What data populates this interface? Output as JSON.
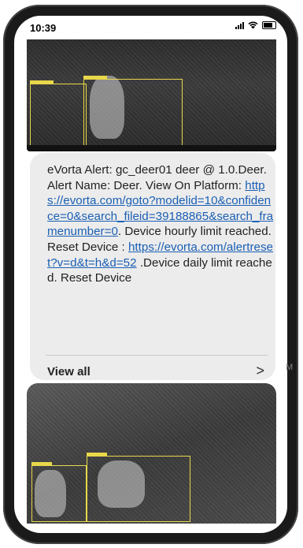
{
  "status_bar": {
    "time": "10:39"
  },
  "message": {
    "text_1": "eVorta Alert: gc_deer01 deer @ 1.0.Deer. Alert Name: Deer. View On Platform: ",
    "link_1": "https://evorta.com/goto?modelid=10&confidence=0&search_fileid=39188865&search_framenumber=0",
    "text_2": ". Device hourly limit reached. Reset Device : ",
    "link_2": "https://evorta.com/alertreset?v=d&t=h&d=52",
    "text_3": " .Device daily limit reached. Reset Device",
    "view_all": "View all",
    "chevron": ">"
  },
  "side_letter": "M",
  "icons": [
    "signal-icon",
    "wifi-icon",
    "battery-icon",
    "chevron-right-icon"
  ]
}
